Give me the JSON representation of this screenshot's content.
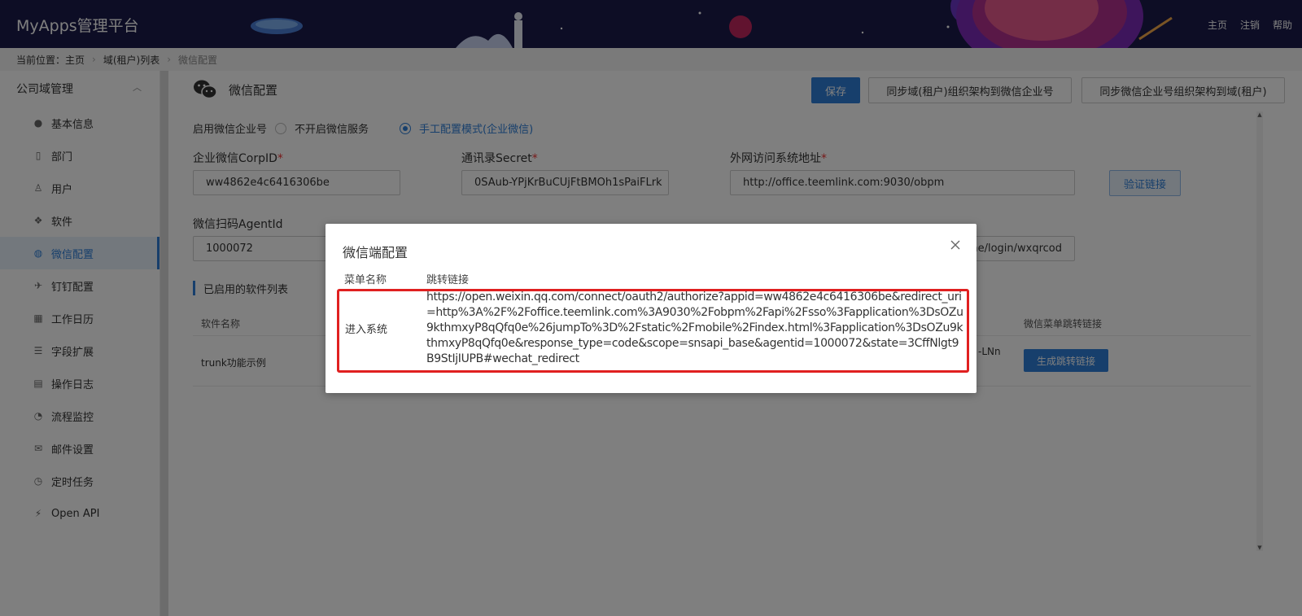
{
  "header": {
    "logo": "MyApps管理平台",
    "nav": [
      "主页",
      "注销",
      "帮助"
    ]
  },
  "breadcrumb": {
    "prefix": "当前位置：",
    "items": [
      "主页",
      "域(租户)列表",
      "微信配置"
    ]
  },
  "sidebar": {
    "group_label": "公司域管理",
    "items": [
      {
        "label": "基本信息",
        "icon": "info-icon"
      },
      {
        "label": "部门",
        "icon": "building-icon"
      },
      {
        "label": "用户",
        "icon": "user-icon"
      },
      {
        "label": "软件",
        "icon": "cubes-icon"
      },
      {
        "label": "微信配置",
        "icon": "wechat-icon",
        "active": true
      },
      {
        "label": "钉钉配置",
        "icon": "plane-icon"
      },
      {
        "label": "工作日历",
        "icon": "calendar-icon"
      },
      {
        "label": "字段扩展",
        "icon": "sliders-icon"
      },
      {
        "label": "操作日志",
        "icon": "log-icon"
      },
      {
        "label": "流程监控",
        "icon": "dashboard-icon"
      },
      {
        "label": "邮件设置",
        "icon": "mail-icon"
      },
      {
        "label": "定时任务",
        "icon": "clock-icon"
      },
      {
        "label": "Open API",
        "icon": "plug-icon"
      }
    ]
  },
  "main": {
    "title": "微信配置",
    "buttons": {
      "save": "保存",
      "sync_to_wechat": "同步域(租户)组织架构到微信企业号",
      "sync_from_wechat": "同步微信企业号组织架构到域(租户)"
    },
    "enable_label": "启用微信企业号",
    "options": [
      "不开启微信服务",
      "手工配置模式(企业微信)"
    ],
    "fields": {
      "corp_id_label": "企业微信CorpID",
      "corp_id_value": "ww4862e4c6416306be",
      "secret_label": "通讯录Secret",
      "secret_value": "0SAub-YPjKrBuCUjFtBMOh1sPaiFLrk",
      "url_label": "外网访问系统地址",
      "url_value": "http://office.teemlink.com:9030/obpm",
      "verify_button": "验证链接",
      "agent_id_label": "微信扫码AgentId",
      "agent_id_value": "1000072",
      "callback_partial": "time/login/wxqrcod"
    },
    "required_mark": "*",
    "section_title": "已启用的软件列表",
    "table": {
      "col_name": "软件名称",
      "col_menu_link": "微信菜单跳转链接",
      "rows": [
        {
          "name": "trunk功能示例",
          "partial": "-LNn",
          "button": "生成跳转链接"
        }
      ]
    }
  },
  "modal": {
    "title": "微信端配置",
    "col_menu": "菜单名称",
    "col_link": "跳转链接",
    "row_name": "进入系统",
    "row_link": "https://open.weixin.qq.com/connect/oauth2/authorize?appid=ww4862e4c6416306be&redirect_uri=http%3A%2F%2Foffice.teemlink.com%3A9030%2Fobpm%2Fapi%2Fsso%3Fapplication%3DsOZu9kthmxyP8qQfq0e%26jumpTo%3D%2Fstatic%2Fmobile%2Findex.html%3Fapplication%3DsOZu9kthmxyP8qQfq0e&response_type=code&scope=snsapi_base&agentid=1000072&state=3CffNlgt9B9StIjIUPB#wechat_redirect"
  },
  "colors": {
    "header_bg": "#1b1a4a",
    "accent": "#2e7fd8",
    "highlight": "#e02020"
  }
}
